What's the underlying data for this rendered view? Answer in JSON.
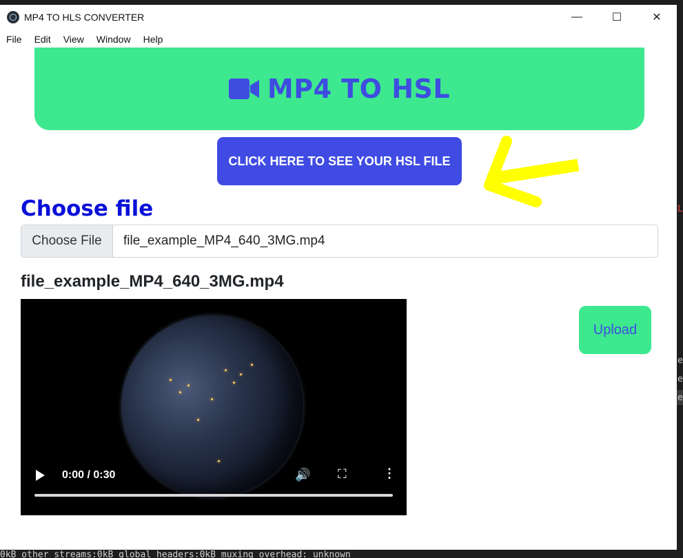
{
  "window": {
    "title": "MP4 TO HLS CONVERTER",
    "controls": {
      "minimize": "—",
      "maximize": "☐",
      "close": "✕"
    }
  },
  "menu": [
    "File",
    "Edit",
    "View",
    "Window",
    "Help"
  ],
  "banner": {
    "title": "MP4 TO HSL",
    "icon": "video-camera-icon"
  },
  "see_file_button": "CLICK HERE TO SEE YOUR HSL FILE",
  "choose_heading": "Choose file",
  "file_input": {
    "button_label": "Choose File",
    "value": "file_example_MP4_640_3MG.mp4"
  },
  "selected_file_label": "file_example_MP4_640_3MG.mp4",
  "video": {
    "time": "0:00 / 0:30",
    "progress": 0.0
  },
  "upload_button": "Upload",
  "terminal_line": "0kB other streams:0kB global headers:0kB muxing overhead: unknown",
  "colors": {
    "accent_green": "#3de88f",
    "accent_blue": "#3f4ce0",
    "heading_blue": "#0a10d8",
    "arrow_yellow": "#ffff00"
  }
}
